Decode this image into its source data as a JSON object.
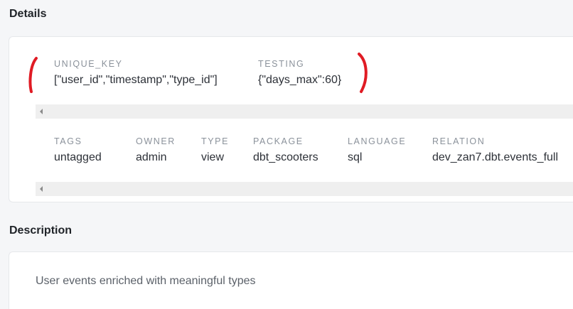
{
  "details": {
    "title": "Details",
    "config_fields": [
      {
        "label": "UNIQUE_KEY",
        "value": "[\"user_id\",\"timestamp\",\"type_id\"]"
      },
      {
        "label": "TESTING",
        "value": "{\"days_max\":60}"
      }
    ],
    "meta_fields": [
      {
        "label": "TAGS",
        "value": "untagged"
      },
      {
        "label": "OWNER",
        "value": "admin"
      },
      {
        "label": "TYPE",
        "value": "view"
      },
      {
        "label": "PACKAGE",
        "value": "dbt_scooters"
      },
      {
        "label": "LANGUAGE",
        "value": "sql"
      },
      {
        "label": "RELATION",
        "value": "dev_zan7.dbt.events_full"
      }
    ]
  },
  "description": {
    "title": "Description",
    "text": "User events enriched with meaningful types"
  },
  "colors": {
    "annotation": "#e01b24",
    "label": "#8b929b",
    "scrollbar": "#efefef"
  },
  "icons": {
    "scroll_left": "scroll-left-arrow-icon",
    "annotation": "red-bracket-annotation"
  }
}
